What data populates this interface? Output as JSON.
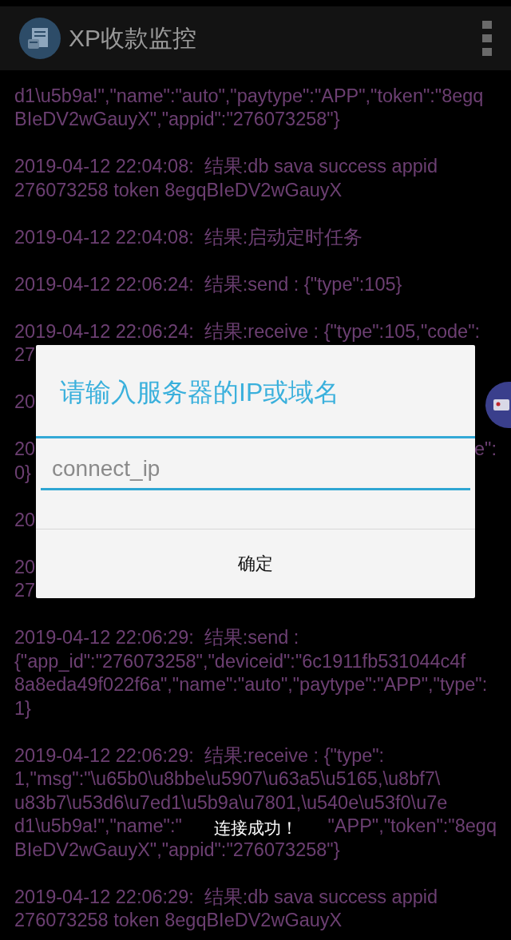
{
  "app_bar": {
    "title": "XP收款监控"
  },
  "log": [
    {
      "lines": [
        {
          "text": "d1\\u5b9a!\",\"name\":\"auto\",\"paytype\":\"APP\",\"token\":\"8egq"
        },
        {
          "text": "BIeDV2wGauyX\",\"appid\":\"276073258\"}"
        }
      ]
    },
    {
      "lines": [
        {
          "text": "2019-04-12 22:04:08:  结果:db sava success appid"
        },
        {
          "text": "276073258 token 8egqBIeDV2wGauyX"
        }
      ]
    },
    {
      "lines": [
        {
          "text": "2019-04-12 22:04:08:  结果:启动定时任务"
        }
      ]
    },
    {
      "lines": [
        {
          "text": "2019-04-12 22:06:24:  结果:send : {\"type\":105}"
        }
      ]
    },
    {
      "lines": [
        {
          "text": "2019-04-12 22:06:24:  结果:receive : {\"type\":105,\"code\":"
        },
        {
          "text": "27"
        }
      ]
    },
    {
      "lines": [
        {
          "text": "20"
        }
      ]
    },
    {
      "lines": [
        {
          "text": "20",
          "tail": "e\":"
        },
        {
          "text": "0}"
        }
      ]
    },
    {
      "lines": [
        {
          "text": "20"
        }
      ]
    },
    {
      "lines": [
        {
          "text": "20"
        },
        {
          "text": "27"
        }
      ]
    },
    {
      "lines": [
        {
          "text": "2019-04-12 22:06:29:  结果:send :"
        },
        {
          "text": "{\"app_id\":\"276073258\",\"deviceid\":\"6c1911fb531044c4f"
        },
        {
          "text": "8a8eda49f022f6a\",\"name\":\"auto\",\"paytype\":\"APP\",\"type\":"
        },
        {
          "text": "1}"
        }
      ]
    },
    {
      "lines": [
        {
          "text": "2019-04-12 22:06:29:  结果:receive : {\"type\":"
        },
        {
          "text": "1,\"msg\":\"\\u65b0\\u8bbe\\u5907\\u63a5\\u5165,\\u8bf7\\"
        },
        {
          "text": "u83b7\\u53d6\\u7ed1\\u5b9a\\u7801,\\u540e\\u53f0\\u7e"
        },
        {
          "text": "d1\\u5b9a!\",\"name\":\"",
          "tail": "\"APP\",\"token\":\"8egq"
        },
        {
          "text": "BIeDV2wGauyX\",\"appid\":\"276073258\"}"
        }
      ]
    },
    {
      "lines": [
        {
          "text": "2019-04-12 22:06:29:  结果:db sava success appid"
        },
        {
          "text": "276073258 token 8egqBIeDV2wGauyX"
        }
      ]
    }
  ],
  "dialog": {
    "title": "请输入服务器的IP或域名",
    "input": {
      "placeholder": "connect_ip"
    },
    "buttons": [
      "确定"
    ]
  },
  "toast": {
    "text": "连接成功！"
  }
}
